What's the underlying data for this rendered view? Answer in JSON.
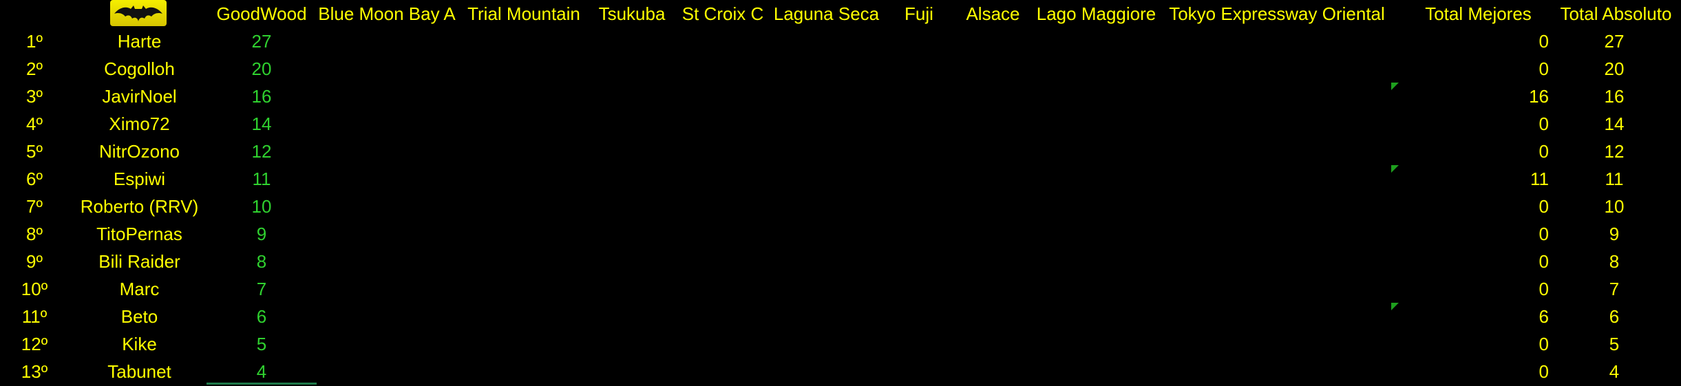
{
  "header": {
    "columns": [
      "GoodWood",
      "Blue Moon Bay A",
      "Trial Mountain",
      "Tsukuba",
      "St Croix C",
      "Laguna Seca",
      "Fuji",
      "Alsace",
      "Lago Maggiore",
      "Tokyo Expressway Oriental",
      "Total Mejores",
      "Total Absoluto"
    ],
    "logo_icon": "batman-logo-icon"
  },
  "rows": [
    {
      "rank": "1º",
      "name": "Harte",
      "goodwood": "27",
      "total_mejores": "0",
      "total_absoluto": "27",
      "comment": false
    },
    {
      "rank": "2º",
      "name": "Cogolloh",
      "goodwood": "20",
      "total_mejores": "0",
      "total_absoluto": "20",
      "comment": false
    },
    {
      "rank": "3º",
      "name": "JavirNoel",
      "goodwood": "16",
      "total_mejores": "16",
      "total_absoluto": "16",
      "comment": true
    },
    {
      "rank": "4º",
      "name": "Ximo72",
      "goodwood": "14",
      "total_mejores": "0",
      "total_absoluto": "14",
      "comment": false
    },
    {
      "rank": "5º",
      "name": "NitrOzono",
      "goodwood": "12",
      "total_mejores": "0",
      "total_absoluto": "12",
      "comment": false
    },
    {
      "rank": "6º",
      "name": "Espiwi",
      "goodwood": "11",
      "total_mejores": "11",
      "total_absoluto": "11",
      "comment": true
    },
    {
      "rank": "7º",
      "name": "Roberto (RRV)",
      "goodwood": "10",
      "total_mejores": "0",
      "total_absoluto": "10",
      "comment": false
    },
    {
      "rank": "8º",
      "name": "TitoPernas",
      "goodwood": "9",
      "total_mejores": "0",
      "total_absoluto": "9",
      "comment": false
    },
    {
      "rank": "9º",
      "name": "Bili Raider",
      "goodwood": "8",
      "total_mejores": "0",
      "total_absoluto": "8",
      "comment": false
    },
    {
      "rank": "10º",
      "name": "Marc",
      "goodwood": "7",
      "total_mejores": "0",
      "total_absoluto": "7",
      "comment": false
    },
    {
      "rank": "11º",
      "name": "Beto",
      "goodwood": "6",
      "total_mejores": "6",
      "total_absoluto": "6",
      "comment": true
    },
    {
      "rank": "12º",
      "name": "Kike",
      "goodwood": "5",
      "total_mejores": "0",
      "total_absoluto": "5",
      "comment": false
    },
    {
      "rank": "13º",
      "name": "Tabunet",
      "goodwood": "4",
      "total_mejores": "0",
      "total_absoluto": "4",
      "comment": false
    }
  ],
  "colors": {
    "background": "#000000",
    "text": "#ffff00",
    "goodwood": "#2fd12f",
    "comment_marker": "#1ea01e"
  }
}
